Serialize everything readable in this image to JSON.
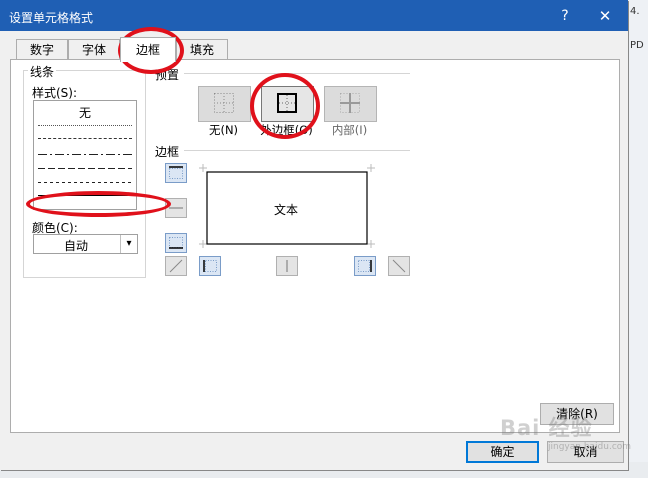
{
  "window": {
    "title": "设置单元格格式",
    "help": "?",
    "close": "✕"
  },
  "background": {
    "right_text_top": "4.",
    "right_text_mid": "PD"
  },
  "tabs": [
    {
      "label": "数字"
    },
    {
      "label": "字体"
    },
    {
      "label": "边框"
    },
    {
      "label": "填充"
    }
  ],
  "line": {
    "group_label": "线条",
    "style_label": "样式(S):",
    "none_label": "无",
    "color_label": "颜色(C):",
    "color_value": "自动"
  },
  "presets": {
    "group_label": "预置",
    "items": [
      {
        "label": "无(N)"
      },
      {
        "label": "外边框(O)"
      },
      {
        "label": "内部(I)"
      }
    ]
  },
  "border": {
    "group_label": "边框",
    "preview_text": "文本"
  },
  "buttons": {
    "clear": "清除(R)",
    "ok": "确定",
    "cancel": "取消"
  },
  "watermark": {
    "main": "Bai 经验",
    "sub": "jingyan.baidu.com"
  },
  "colors": {
    "titlebar": "#1f5fb4",
    "annotation": "#e0111b",
    "accent_button": "#0078d7"
  }
}
